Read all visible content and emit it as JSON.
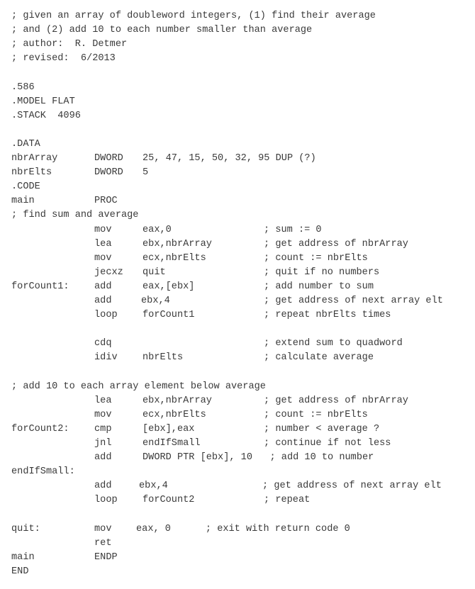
{
  "document": {
    "lines": [
      {
        "full": "; given an array of doubleword integers, (1) find their average"
      },
      {
        "full": "; and (2) add 10 to each number smaller than average"
      },
      {
        "full": "; author:  R. Detmer"
      },
      {
        "full": "; revised:  6/2013"
      },
      {},
      {
        "full": ".586"
      },
      {
        "full": ".MODEL FLAT"
      },
      {
        "full": ".STACK  4096"
      },
      {},
      {
        "full": ".DATA"
      },
      {
        "label": "nbrArray",
        "op": "DWORD",
        "arg": "25, 47, 15, 50, 32, 95 DUP (?)"
      },
      {
        "label": "nbrElts",
        "op": "DWORD",
        "arg": "5"
      },
      {
        "full": ".CODE"
      },
      {
        "label": "main",
        "op": "PROC"
      },
      {
        "full": "; find sum and average"
      },
      {
        "op": "mov",
        "arg": "eax,0",
        "cmt": "; sum := 0"
      },
      {
        "op": "lea",
        "arg": "ebx,nbrArray",
        "cmt": "; get address of nbrArray"
      },
      {
        "op": "mov",
        "arg": "ecx,nbrElts",
        "cmt": "; count := nbrElts"
      },
      {
        "op": "jecxz",
        "arg": "quit",
        "cmt": "; quit if no numbers"
      },
      {
        "label": "forCount1:",
        "op": "add",
        "arg": "eax,[ebx]",
        "cmt": "; add number to sum"
      },
      {
        "op": "add",
        "arg": "ebx,4",
        "cmt": "; get address of next array elt"
      },
      {
        "op": "loop",
        "arg": "forCount1",
        "cmt": "; repeat nbrElts times"
      },
      {},
      {
        "op": "cdq",
        "cmt": "; extend sum to quadword"
      },
      {
        "op": "idiv",
        "arg": "nbrElts",
        "cmt": "; calculate average"
      },
      {},
      {
        "full": "; add 10 to each array element below average"
      },
      {
        "op": "lea",
        "arg": "ebx,nbrArray",
        "cmt": "; get address of nbrArray"
      },
      {
        "op": "mov",
        "arg": "ecx,nbrElts",
        "cmt": "; count := nbrElts"
      },
      {
        "label": "forCount2:",
        "op": "cmp",
        "arg": "[ebx],eax",
        "cmt": "; number < average ?"
      },
      {
        "op": "jnl",
        "arg": "endIfSmall",
        "cmt": "; continue if not less"
      },
      {
        "op": "add",
        "arg": "DWORD PTR [ebx], 10   ; add 10 to number"
      },
      {
        "label": "endIfSmall:"
      },
      {
        "op": "add",
        "arg": "ebx,4",
        "cmt": "; get address of next array elt"
      },
      {
        "op": "loop",
        "arg": "forCount2",
        "cmt": "; repeat"
      },
      {},
      {
        "label": "quit:",
        "op": "mov",
        "arg": "eax, 0      ; exit with return code 0"
      },
      {
        "op": "ret"
      },
      {
        "label": "main",
        "op": "ENDP"
      },
      {
        "full": "END"
      }
    ]
  }
}
